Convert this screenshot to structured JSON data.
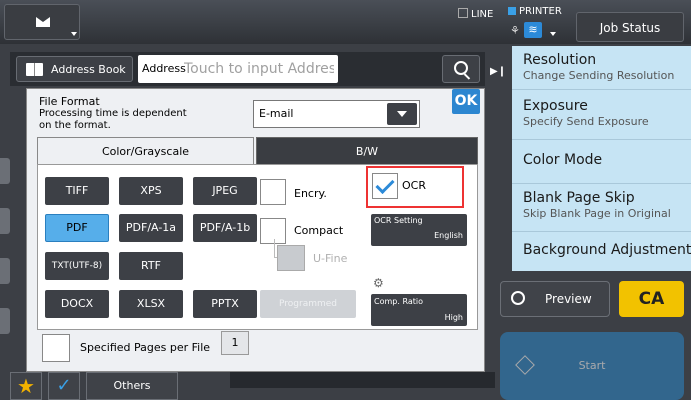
{
  "topbar": {
    "mode_icon": "envelope-icon",
    "line_label": "LINE",
    "printer_label": "PRINTER",
    "job_status_label": "Job Status"
  },
  "address_bar": {
    "address_book_label": "Address Book",
    "address_label": "Address",
    "address_placeholder": "Touch to input Address"
  },
  "right_panel": {
    "items": [
      {
        "title": "Resolution",
        "subtitle": "Change Sending Resolution"
      },
      {
        "title": "Exposure",
        "subtitle": "Specify Send Exposure"
      },
      {
        "title": "Color Mode",
        "subtitle": ""
      },
      {
        "title": "Blank Page Skip",
        "subtitle": "Skip Blank Page in Original"
      },
      {
        "title": "Background Adjustment",
        "subtitle": ""
      }
    ],
    "preview_label": "Preview",
    "ca_label": "CA",
    "start_label": "Start"
  },
  "bottom": {
    "others_label": "Others"
  },
  "dialog": {
    "title": "File Format",
    "note_line1": "Processing time is dependent",
    "note_line2": "on the format.",
    "dropdown_value": "E-mail",
    "ok_label": "OK",
    "tabs": [
      "Color/Grayscale",
      "B/W"
    ],
    "formats": [
      "TIFF",
      "XPS",
      "JPEG",
      "PDF",
      "PDF/A-1a",
      "PDF/A-1b",
      "TXT(UTF-8)",
      "RTF",
      "DOCX",
      "XLSX",
      "PPTX",
      "Programmed"
    ],
    "encry_label": "Encry.",
    "compact_label": "Compact",
    "ufine_label": "U-Fine",
    "ocr_label": "OCR",
    "ocr_setting_label": "OCR Setting",
    "ocr_setting_value": "English",
    "comp_ratio_label": "Comp. Ratio",
    "comp_ratio_value": "High",
    "specified_pages_label": "Specified Pages per File",
    "specified_pages_value": "1"
  }
}
